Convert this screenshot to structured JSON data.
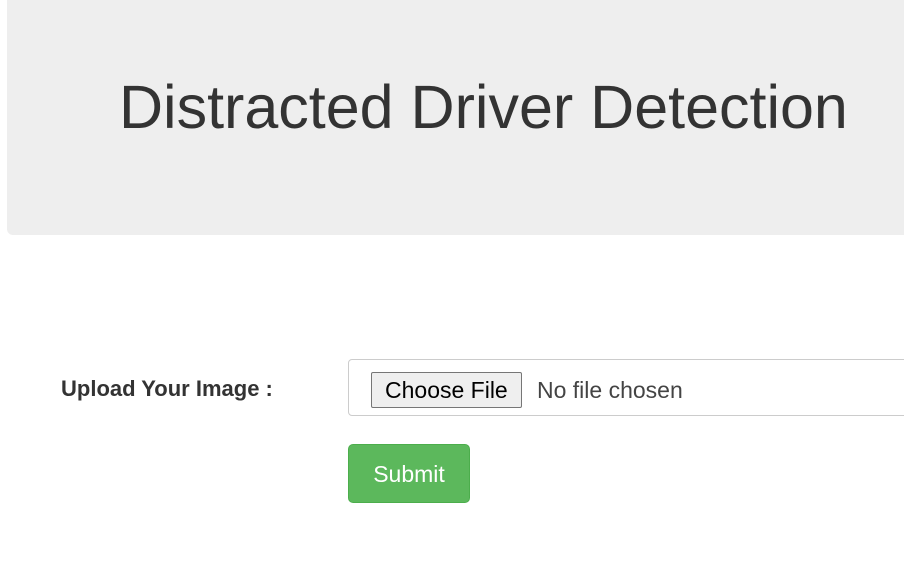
{
  "header": {
    "title": "Distracted Driver Detection"
  },
  "upload_form": {
    "label": "Upload Your Image :",
    "choose_file_label": "Choose File",
    "file_status": "No file chosen",
    "submit_label": "Submit"
  },
  "colors": {
    "header_background": "#eeeeee",
    "submit_background": "#5cb85c",
    "text": "#333333"
  }
}
